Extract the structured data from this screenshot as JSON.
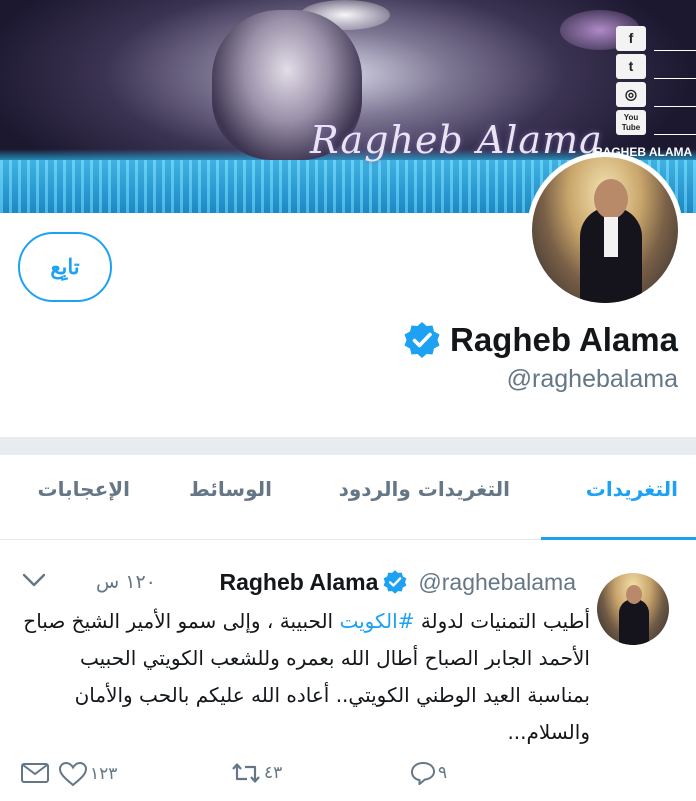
{
  "banner": {
    "script_text": "Ragheb Alama",
    "brand_text": "RAGHEB ALAMA",
    "social_icons": [
      "facebook-icon",
      "twitter-icon",
      "instagram-icon",
      "youtube-icon"
    ],
    "social_labels": [
      "f",
      "t",
      "◎",
      "You Tube"
    ]
  },
  "profile": {
    "follow_label": "تابِع",
    "display_name": "Ragheb Alama",
    "handle": "@raghebalama",
    "verified": true
  },
  "tabs": [
    {
      "label": "التغريدات",
      "active": true
    },
    {
      "label": "التغريدات والردود",
      "active": false
    },
    {
      "label": "الوسائط",
      "active": false
    },
    {
      "label": "الإعجابات",
      "active": false
    }
  ],
  "tweet": {
    "author_name": "Ragheb Alama",
    "author_handle": "@raghebalama",
    "time": "١٢٠ س",
    "text_before": "أطيب التمنيات لدولة ",
    "hashtag": "#الكويت",
    "text_after": " الحبيبة ، وإلى سمو الأمير الشيخ صباح الأحمد الجابر الصباح أطال الله بعمره  وللشعب الكويتي  الحبيب بمناسبة العيد الوطني الكويتي.. أعاده الله عليكم بالحب والأمان والسلام...",
    "replies": "٩",
    "retweets": "٤٣",
    "likes": "١٢٣"
  },
  "colors": {
    "accent": "#1da1f2",
    "muted": "#657786",
    "text": "#14171a",
    "separator": "#e6ecf0"
  }
}
